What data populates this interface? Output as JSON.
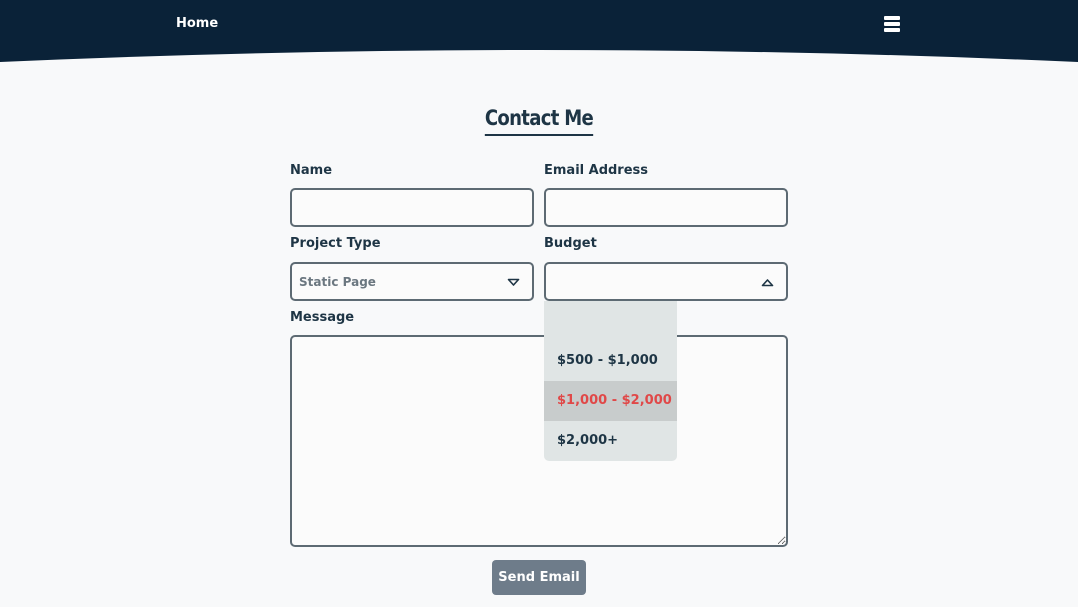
{
  "header": {
    "home_label": "Home",
    "menu_icon": "hamburger-menu-icon",
    "background_color": "#0a2238"
  },
  "title": "Contact Me",
  "form": {
    "name_label": "Name",
    "name_value": "",
    "email_label": "Email Address",
    "email_value": "",
    "project_type_label": "Project Type",
    "project_type_value": "Static Page",
    "budget_label": "Budget",
    "budget_value": "",
    "budget_options": [
      {
        "label": ""
      },
      {
        "label": "$500 - $1,000"
      },
      {
        "label": "$1,000 - $2,000",
        "highlighted": true
      },
      {
        "label": "$2,000+"
      }
    ],
    "message_label": "Message",
    "message_value": "",
    "send_label": "Send Email",
    "highlight_color": "#e04848"
  }
}
